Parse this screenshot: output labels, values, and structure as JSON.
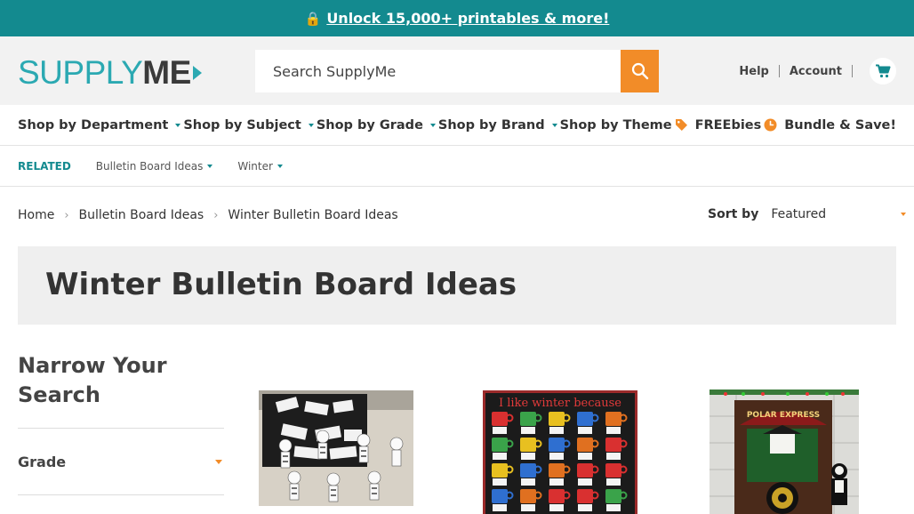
{
  "promo": {
    "text": "Unlock 15,000+ printables & more!"
  },
  "header": {
    "logo_light": "SUPPLY",
    "logo_bold": "ME",
    "search_placeholder": "Search SupplyMe",
    "links": [
      "Help",
      "Account"
    ]
  },
  "nav": {
    "items": [
      {
        "label": "Shop by Department"
      },
      {
        "label": "Shop by Subject"
      },
      {
        "label": "Shop by Grade"
      },
      {
        "label": "Shop by Brand"
      },
      {
        "label": "Shop by Theme"
      },
      {
        "label": "FREEbies"
      },
      {
        "label": "Bundle & Save!"
      }
    ]
  },
  "related": {
    "label": "RELATED",
    "items": [
      "Bulletin Board Ideas",
      "Winter"
    ]
  },
  "breadcrumb": [
    "Home",
    "Bulletin Board Ideas",
    "Winter Bulletin Board Ideas"
  ],
  "sort": {
    "label": "Sort by",
    "value": "Featured"
  },
  "page_title": "Winter Bulletin Board Ideas",
  "sidebar": {
    "heading": "Narrow Your Search",
    "facets": [
      "Grade"
    ]
  },
  "products": [
    {
      "image": "snowman-bulletin-board-thumbnail"
    },
    {
      "image": "i-like-winter-because-mugs-thumbnail",
      "image_text": "I like winter because"
    },
    {
      "image": "polar-express-door-thumbnail",
      "image_text": "POLAR EXPRESS"
    }
  ],
  "colors": {
    "teal": "#138a8f",
    "orange": "#f28c28",
    "logo_teal": "#2ba9b2"
  }
}
